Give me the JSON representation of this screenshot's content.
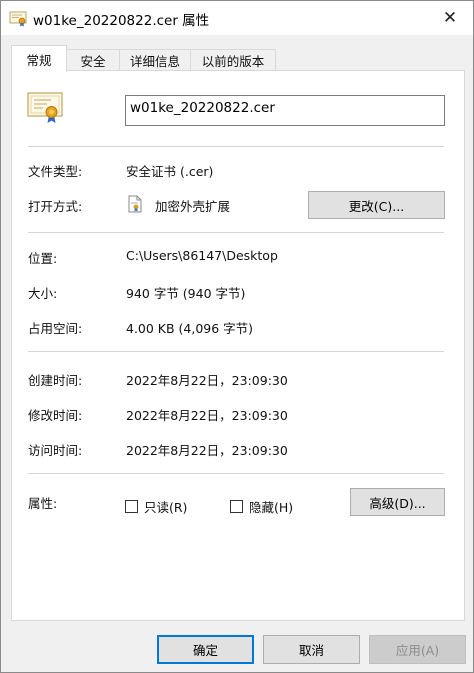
{
  "window": {
    "title": "w01ke_20220822.cer 属性",
    "close_label": "✕"
  },
  "tabs": [
    {
      "label": "常规",
      "active": true
    },
    {
      "label": "安全",
      "active": false
    },
    {
      "label": "详细信息",
      "active": false
    },
    {
      "label": "以前的版本",
      "active": false
    }
  ],
  "general": {
    "filename": "w01ke_20220822.cer",
    "file_type_label": "文件类型:",
    "file_type_value": "安全证书 (.cer)",
    "open_with_label": "打开方式:",
    "open_with_value": "加密外壳扩展",
    "change_button": "更改(C)...",
    "location_label": "位置:",
    "location_value": "C:\\Users\\86147\\Desktop",
    "size_label": "大小:",
    "size_value": "940 字节 (940 字节)",
    "disk_size_label": "占用空间:",
    "disk_size_value": "4.00 KB (4,096 字节)",
    "created_label": "创建时间:",
    "created_value": "2022年8月22日，23:09:30",
    "modified_label": "修改时间:",
    "modified_value": "2022年8月22日，23:09:30",
    "accessed_label": "访问时间:",
    "accessed_value": "2022年8月22日，23:09:30",
    "attributes_label": "属性:",
    "readonly_label": "只读(R)",
    "readonly_checked": false,
    "hidden_label": "隐藏(H)",
    "hidden_checked": false,
    "advanced_button": "高级(D)..."
  },
  "footer": {
    "ok": "确定",
    "cancel": "取消",
    "apply": "应用(A)"
  },
  "icons": {
    "title": "certificate-icon",
    "file": "certificate-icon",
    "open_with": "crypto-shell-icon",
    "close": "close-icon"
  },
  "colors": {
    "accent": "#0078d7",
    "panel": "#ffffff",
    "window": "#f0f0f0"
  }
}
